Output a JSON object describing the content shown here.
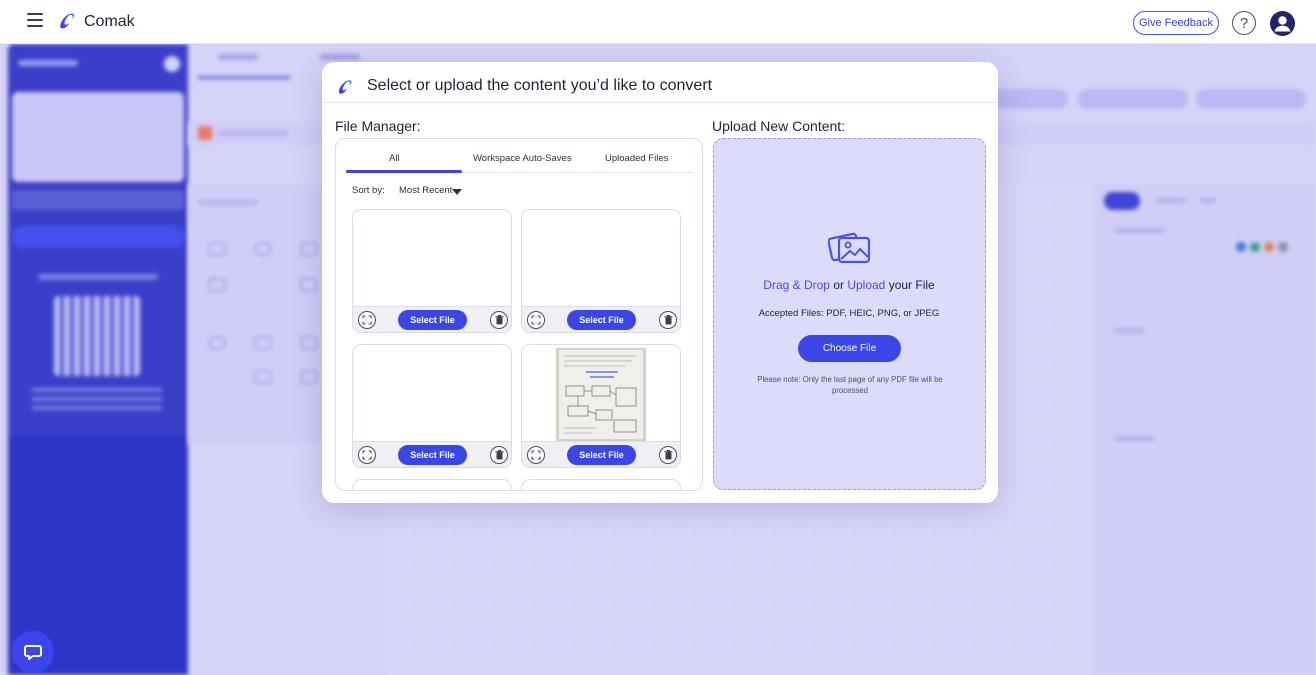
{
  "app": {
    "brand": "Comak",
    "feedback_label": "Give Feedback",
    "help_label": "?"
  },
  "modal": {
    "title": "Select or upload the content you’d like to convert",
    "file_manager_label": "File Manager:",
    "upload_label": "Upload New Content:",
    "tabs": [
      {
        "label": "All",
        "active": true
      },
      {
        "label": "Workspace Auto-Saves",
        "active": false
      },
      {
        "label": "Uploaded Files",
        "active": false
      }
    ],
    "sort_by_label": "Sort by:",
    "sort_value": "Most Recent",
    "files": [
      {
        "select_label": "Select File",
        "preview": "blank"
      },
      {
        "select_label": "Select File",
        "preview": "blank"
      },
      {
        "select_label": "Select File",
        "preview": "blank"
      },
      {
        "select_label": "Select File",
        "preview": "photo"
      }
    ],
    "upload": {
      "drag_drop": "Drag & Drop",
      "or_text": " or ",
      "upload_link": "Upload",
      "your_file": " your File",
      "accepted": "Accepted Files: PDF, HEIC, PNG, or JPEG",
      "choose_button": "Choose File",
      "note": "Please note: Only the last page of any PDF file will be processed"
    }
  },
  "icons": {
    "menu": "hamburger-icon",
    "logo": "comak-logo-icon",
    "help": "question-circle-icon",
    "avatar": "user-avatar-icon",
    "expand": "expand-icon",
    "delete": "trash-icon",
    "upload": "image-upload-icon",
    "chat": "chat-bubble-icon",
    "sort_caret": "caret-down-icon"
  },
  "colors": {
    "accent": "#3a47e6",
    "overlay": "#d5d3f8",
    "upload_zone": "#dcdbfa",
    "sidebar": "#2e34c6"
  }
}
